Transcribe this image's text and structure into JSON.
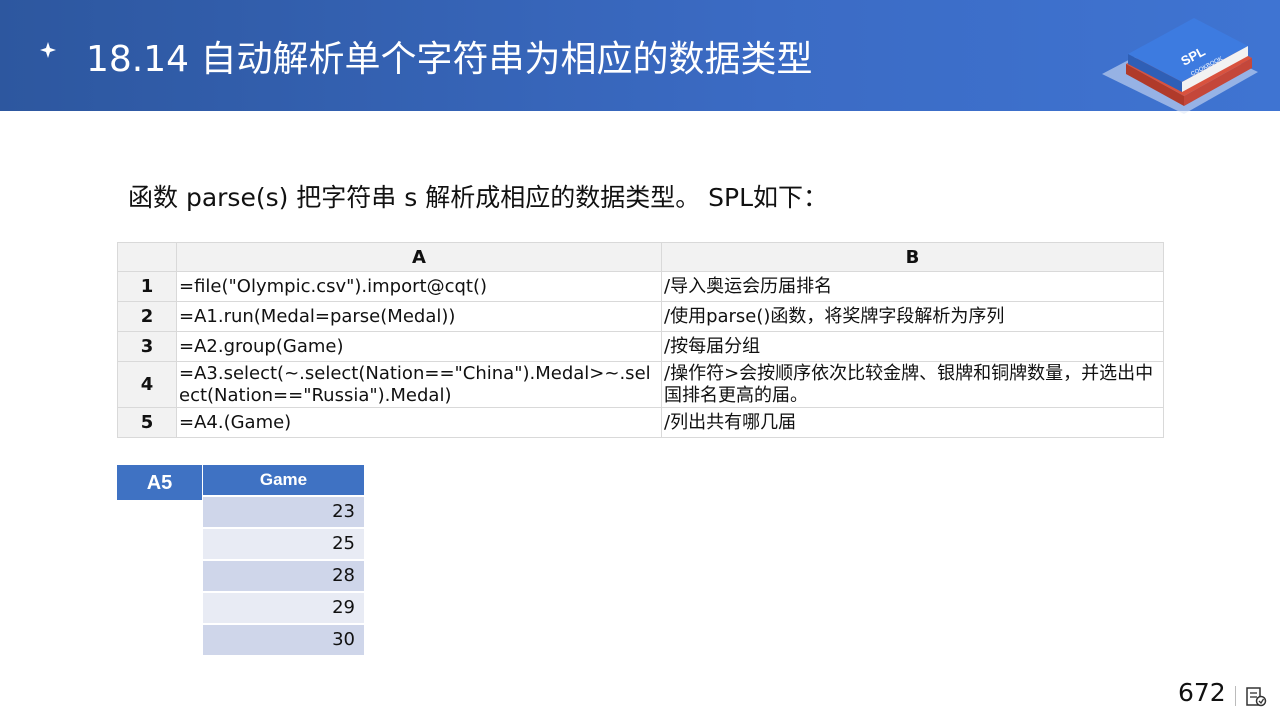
{
  "header": {
    "title": "18.14  自动解析单个字符串为相应的数据类型",
    "logo_text": "SPL",
    "logo_subtext": "COOKBOOK",
    "bg_color": "#2d579f"
  },
  "intro": "函数 parse(s) 把字符串 s 解析成相应的数据类型。 SPL如下：",
  "grid": {
    "columns": [
      "A",
      "B"
    ],
    "rows": [
      {
        "num": "1",
        "a": "=file(\"Olympic.csv\").import@cqt()",
        "b": "/导入奥运会历届排名"
      },
      {
        "num": "2",
        "a": "=A1.run(Medal=parse(Medal))",
        "b": "/使用parse()函数，将奖牌字段解析为序列"
      },
      {
        "num": "3",
        "a": "=A2.group(Game)",
        "b": "/按每届分组"
      },
      {
        "num": "4",
        "a": "=A3.select(~.select(Nation==\"China\").Medal>~.select(Nation==\"Russia\").Medal)",
        "b": "/操作符>会按顺序依次比较金牌、银牌和铜牌数量，并选出中国排名更高的届。"
      },
      {
        "num": "5",
        "a": "=A4.(Game)",
        "b": "/列出共有哪几届"
      }
    ]
  },
  "result": {
    "cell": "A5",
    "header": "Game",
    "values": [
      "23",
      "25",
      "28",
      "29",
      "30"
    ]
  },
  "footer": {
    "page_number": "672",
    "icon": "notes-icon"
  },
  "colors": {
    "accent": "#3f72c3",
    "row_odd": "#cfd6ea",
    "row_even": "#e8ebf4"
  }
}
